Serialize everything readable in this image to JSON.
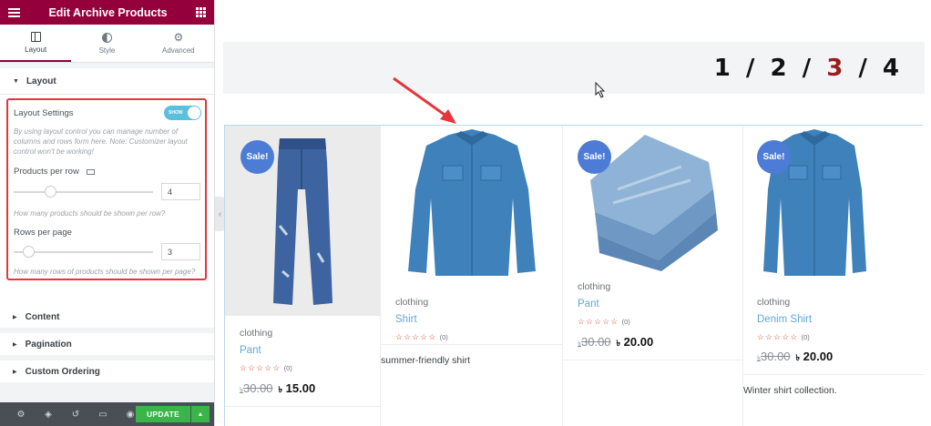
{
  "sidebar": {
    "title": "Edit Archive Products",
    "tabs": [
      {
        "label": "Layout",
        "icon": "layout-icon"
      },
      {
        "label": "Style",
        "icon": "style-icon"
      },
      {
        "label": "Advanced",
        "icon": "gear-icon"
      }
    ],
    "layout_section": {
      "title": "Layout",
      "settings_label": "Layout Settings",
      "toggle_label": "SHOW",
      "help_text": "By using layout control you can manage number of columns and rows form here. Note: Customizer layout control won't be working!",
      "products_per_row_label": "Products per row",
      "products_per_row_value": "4",
      "products_per_row_help": "How many products should be shown per row?",
      "rows_per_page_label": "Rows per page",
      "rows_per_page_value": "3",
      "rows_per_page_help": "How many rows of products should be shown per page?"
    },
    "sections": [
      "Content",
      "Pagination",
      "Custom Ordering"
    ],
    "footer": {
      "update_label": "UPDATE",
      "icons": [
        "settings-icon",
        "layers-icon",
        "history-icon",
        "responsive-icon",
        "preview-eye-icon"
      ]
    }
  },
  "preview": {
    "pagination": {
      "sep": "/",
      "pages": [
        "1",
        "2",
        "3",
        "4"
      ],
      "current": "3"
    },
    "products": [
      {
        "sale": "Sale!",
        "category": "clothing",
        "name": "Pant",
        "rating_count": "(0)",
        "old_price": "30.00",
        "price": "15.00",
        "currency": "৳",
        "description": ""
      },
      {
        "sale": "",
        "category": "clothing",
        "name": "Shirt",
        "rating_count": "(0)",
        "old_price": "",
        "price": "",
        "currency": "৳",
        "description": "summer-friendly shirt"
      },
      {
        "sale": "Sale!",
        "category": "clothing",
        "name": "Pant",
        "rating_count": "(0)",
        "old_price": "30.00",
        "price": "20.00",
        "currency": "৳",
        "description": ""
      },
      {
        "sale": "Sale!",
        "category": "clothing",
        "name": "Denim Shirt",
        "rating_count": "(0)",
        "old_price": "30.00",
        "price": "20.00",
        "currency": "৳",
        "description": "Winter shirt collection."
      }
    ],
    "stars": "☆☆☆☆☆"
  },
  "colors": {
    "brand": "#93003c",
    "toggle": "#5bc0de",
    "sale_badge": "#4d7cd6",
    "product_link": "#62a7d8",
    "annotation_red": "#e4373a",
    "current_page": "#9b1c1c",
    "update_button": "#39b54a"
  }
}
